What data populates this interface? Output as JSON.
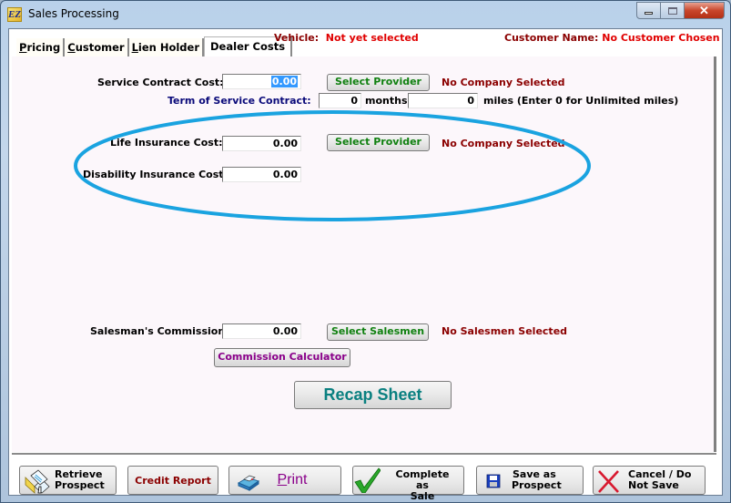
{
  "window": {
    "title": "Sales Processing",
    "app_icon_text": "EZ",
    "controls": {
      "minimize": "minimize",
      "maximize": "maximize",
      "close": "✕"
    }
  },
  "tabs": [
    {
      "label_u": "P",
      "label_rest": "ricing",
      "active": false
    },
    {
      "label_u": "C",
      "label_rest": "ustomer",
      "active": false
    },
    {
      "label_u": "L",
      "label_rest": "ien Holder",
      "active": false
    },
    {
      "label_u": "",
      "label_rest": "Dealer Costs",
      "active": true
    }
  ],
  "header": {
    "vehicle_label": "Vehicle:",
    "vehicle_value": "Not yet selected",
    "customer_label": "Customer Name:",
    "customer_value": "No Customer Chosen"
  },
  "service_contract": {
    "label": "Service Contract Cost:",
    "value": "0.00",
    "button": "Select Provider",
    "status": "No Company Selected",
    "term_label": "Term of Service Contract:",
    "months_value": "0",
    "months_label": "months,",
    "miles_value": "0",
    "miles_label": "miles (Enter 0 for Unlimited miles)"
  },
  "life_insurance": {
    "label": "Life Insurance Cost:",
    "value": "0.00",
    "button": "Select Provider",
    "status": "No Company Selected"
  },
  "disability_insurance": {
    "label": "Disability Insurance Cost:",
    "value": "0.00"
  },
  "commission": {
    "label": "Salesman's Commission:",
    "value": "0.00",
    "button": "Select Salesmen",
    "status": "No Salesmen Selected",
    "calculator_button": "Commission Calculator"
  },
  "recap_button": "Recap Sheet",
  "annotation": {
    "color": "#1aa3e0"
  },
  "bottom_buttons": {
    "retrieve": [
      "Retrieve",
      "Prospect"
    ],
    "credit_report": "Credit Report",
    "print_u": "P",
    "print_rest": "rint",
    "complete": [
      "Complete as",
      "Sale"
    ],
    "save": [
      "Save as",
      "Prospect"
    ],
    "cancel": [
      "Cancel / Do",
      "Not Save"
    ]
  }
}
